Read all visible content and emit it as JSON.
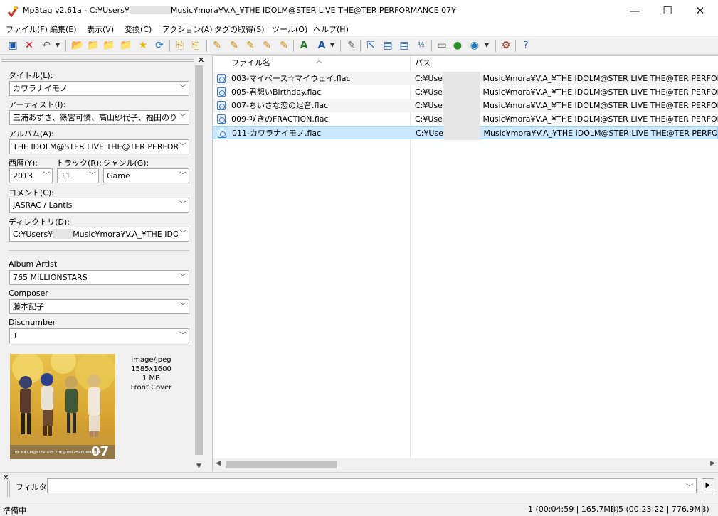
{
  "window": {
    "title_prefix": "Mp3tag v2.61a  -  C:¥Users¥",
    "title_suffix": "Music¥mora¥V.A_¥THE IDOLM@STER LIVE THE@TER PERFORMANCE 07¥",
    "minimize": "—",
    "maximize": "☐",
    "close": "✕"
  },
  "menu": [
    "ファイル(F)",
    "編集(E)",
    "表示(V)",
    "変換(C)",
    "アクション(A)",
    "タグの取得(S)",
    "ツール(O)",
    "ヘルプ(H)"
  ],
  "toolbar": {
    "icons": [
      "save-icon",
      "remove-tag-icon",
      "undo-icon",
      "change-directory-icon",
      "add-directory-icon",
      "open-icon",
      "favorites-icon",
      "refresh-icon",
      "copy-tag-icon",
      "paste-tag-icon",
      "tag-to-filename-icon",
      "filename-to-tag-icon",
      "text-file-icon",
      "autonumber-icon",
      "case-conversion-icon",
      "actions-icon",
      "export-icon",
      "playlist-icon",
      "options-icon",
      "help-icon"
    ]
  },
  "tag_panel": {
    "title": {
      "label": "タイトル(L):",
      "value": "カワラナイモノ"
    },
    "artist": {
      "label": "アーティスト(I):",
      "value": "三浦あずさ、篠宮可憐、高山紗代子、福田のり"
    },
    "album": {
      "label": "アルバム(A):",
      "value": "THE IDOLM@STER LIVE THE@TER PERFORMAN"
    },
    "year": {
      "label": "西暦(Y):",
      "value": "2013"
    },
    "track": {
      "label": "トラック(R):",
      "value": "11"
    },
    "genre": {
      "label": "ジャンル(G):",
      "value": "Game"
    },
    "comment": {
      "label": "コメント(C):",
      "value": "JASRAC / Lantis"
    },
    "directory": {
      "label": "ディレクトリ(D):",
      "value_prefix": "C:¥Users¥",
      "value_suffix": "Music¥mora¥V.A_¥THE IDOLM@"
    },
    "album_artist": {
      "label": "Album Artist",
      "value": "765 MILLIONSTARS"
    },
    "composer": {
      "label": "Composer",
      "value": "藤本記子"
    },
    "discnumber": {
      "label": "Discnumber",
      "value": "1"
    },
    "cover": {
      "mime": "image/jpeg",
      "dimensions": "1585x1600",
      "size": "1 MB",
      "type": "Front Cover",
      "art_title": "THE IDOLM@STER LIVE THE@TER PERFORMANCE",
      "art_number": "07"
    }
  },
  "file_list": {
    "columns": [
      "ファイル名",
      "パス"
    ],
    "rows": [
      {
        "name": "003-マイペース☆マイウェイ.flac",
        "path_prefix": "C:¥User",
        "path_suffix": "Music¥mora¥V.A_¥THE IDOLM@STER LIVE THE@TER PERFORMA"
      },
      {
        "name": "005-君想いBirthday.flac",
        "path_prefix": "C:¥User",
        "path_suffix": "Music¥mora¥V.A_¥THE IDOLM@STER LIVE THE@TER PERFORMA"
      },
      {
        "name": "007-ちいさな恋の足音.flac",
        "path_prefix": "C:¥User",
        "path_suffix": "Music¥mora¥V.A_¥THE IDOLM@STER LIVE THE@TER PERFORMA"
      },
      {
        "name": "009-咲きのFRACTION.flac",
        "path_prefix": "C:¥User",
        "path_suffix": "Music¥mora¥V.A_¥THE IDOLM@STER LIVE THE@TER PERFORMA"
      },
      {
        "name": "011-カワラナイモノ.flac",
        "path_prefix": "C:¥User",
        "path_suffix": "Music¥mora¥V.A_¥THE IDOLM@STER LIVE THE@TER PERFORMA",
        "selected": true
      }
    ]
  },
  "filter": {
    "label": "フィルタ:",
    "value": ""
  },
  "status": {
    "left": "準備中",
    "selected": "1 (00:04:59 | 165.7MB)",
    "total": "5 (00:23:22 | 776.9MB)"
  },
  "colors": {
    "selection": "#cce8ff",
    "selection_border": "#99d1ff",
    "accent": "#3a7bd5"
  }
}
